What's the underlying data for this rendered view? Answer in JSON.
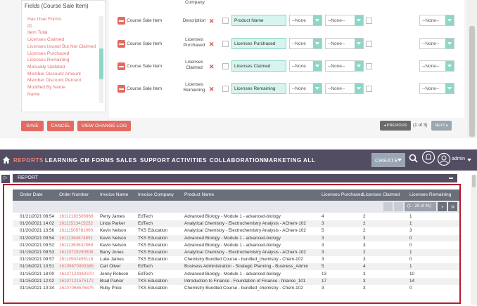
{
  "fields_panel": {
    "title": "Fields (Course Sale Item)",
    "items": [
      "Has User Forms",
      "ID",
      "Item Total",
      "Licenses Claimed",
      "Licenses Issued But Not Claimed",
      "Licenses Purchased",
      "Licenses Remaining",
      "Manually Updated",
      "Member Discount Amount",
      "Member Discount Percent",
      "Modified By Name",
      "Name"
    ]
  },
  "editor": {
    "top_partial_label": "Company",
    "rows": [
      {
        "module": "Course Sale Item",
        "field": "Description",
        "input": "Product Name",
        "sel1": "--None",
        "sel2": "--None--",
        "sel3": "--None--"
      },
      {
        "module": "Course Sale Item",
        "field": "Licenses Purchased",
        "input": "Licenses Purchased",
        "sel1": "--None",
        "sel2": "--None--",
        "sel3": "--None--"
      },
      {
        "module": "Course Sale Item",
        "field": "Licenses Claimed",
        "input": "Licenses Claimed",
        "sel1": "--None",
        "sel2": "--None--",
        "sel3": "--None--"
      },
      {
        "module": "Course Sale Item",
        "field": "Licenses Remaining",
        "input": "Licenses Remaining",
        "sel1": "--None",
        "sel2": "--None--",
        "sel3": "--None--"
      }
    ],
    "buttons": {
      "save": "SAVE",
      "cancel": "CANCEL",
      "change_log": "VIEW CHANGE LOG"
    },
    "pager": {
      "previous": "PREVIOUS",
      "count": "(1 of 3)",
      "next": "NEXT"
    }
  },
  "nav": {
    "items": [
      "REPORTS",
      "LEARNING",
      "CM FORMS",
      "SALES",
      "SUPPORT",
      "ACTIVITIES",
      "COLLABORATION",
      "MARKETING",
      "ALL"
    ],
    "create": "CREATE",
    "user": "admin"
  },
  "report": {
    "title": "REPORT",
    "columns": [
      "Order Date",
      "Order Number",
      "Invoice Name",
      "Invoice Company",
      "Product Name",
      "Licenses Purchased",
      "Licenses Claimed",
      "Licenses Remaining"
    ],
    "page_count": "(1 - 20 of 41)",
    "rows": [
      [
        "01/21/2021 08:54",
        "16112192506968",
        "Perry James",
        "EdTech",
        "Advanced Biology - Module 1 - advanced-biology",
        "4",
        "2",
        "1"
      ],
      [
        "01/20/2021 14:02",
        "16111513415252",
        "Linda Parker",
        "EdTech",
        "Analytical Chemistry - Electrochemistry Analysis - AChem-102",
        "3",
        "2",
        "1"
      ],
      [
        "01/20/2021 13:56",
        "16111509781060",
        "Kevin Nelson",
        "TKS Education",
        "Analytical Chemistry - Electrochemistry Analysis - AChem-102",
        "5",
        "2",
        "3"
      ],
      [
        "01/20/2021 09:54",
        "16111364874891",
        "Kevin Nelson",
        "TKS Education",
        "Advanced Biology - Module 1 - advanced-biology",
        "3",
        "3",
        "0"
      ],
      [
        "01/20/2021 09:52",
        "16111363632569",
        "Kevin Nelson",
        "TKS Education",
        "Advanced Biology - Module 1 - advanced-biology",
        "3",
        "3",
        "0"
      ],
      [
        "01/19/2021 09:53",
        "16110729290508",
        "Barry Jones",
        "TKS Education",
        "Analytical Chemistry - Electrochemistry Analysis - AChem-102",
        "3",
        "2",
        "1"
      ],
      [
        "01/19/2021 09:57",
        "16110502455119",
        "Luke James",
        "TKS Education",
        "Chemistry Bundled Course - bundled_chemistry - Chem-102",
        "3",
        "3",
        "0"
      ],
      [
        "01/16/2021 10:51",
        "16109670993386",
        "Carl Oliver",
        "EdTech",
        "Business Administration - Strategic Planning - Business_Admin",
        "5",
        "4",
        "1"
      ],
      [
        "01/15/2021 18:00",
        "16107124943370",
        "Jenny Robson",
        "EdTech",
        "Advanced Biology - Module 1 - advanced-biology",
        "13",
        "3",
        "10"
      ],
      [
        "01/15/2021 12:02",
        "16107121575172",
        "Brad Parker",
        "TKS Education",
        "Introduction to Finance - Foundation of Finance - finance_101",
        "17",
        "3",
        "14"
      ],
      [
        "01/15/2021 10:34",
        "16107066576875",
        "Ruby Price",
        "TKS Education",
        "Chemistry Bundled Course - bundled_chemistry - Chem-102",
        "3",
        "3",
        "0"
      ]
    ]
  },
  "colors": {
    "accent": "#e36b62",
    "nav": "#534d64",
    "highlight_border": "#b01e2b",
    "teal": "#8fd6c6"
  }
}
